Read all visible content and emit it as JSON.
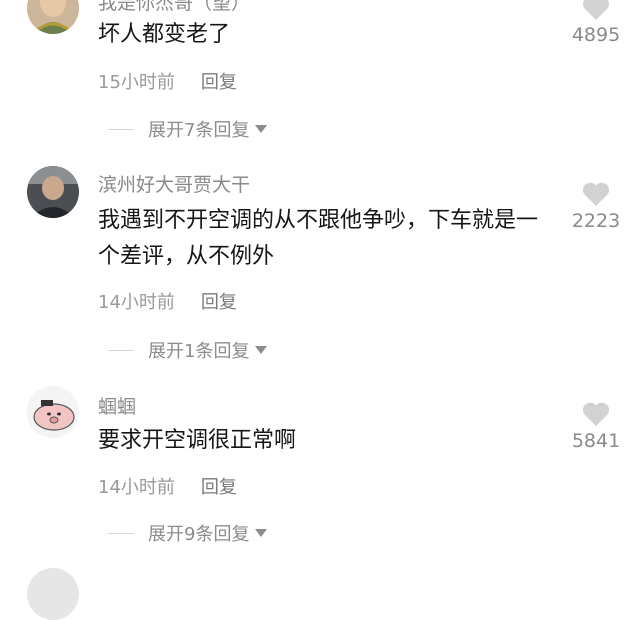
{
  "comments": [
    {
      "username": "我是你杰哥（望）",
      "text": "坏人都变老了",
      "time": "15小时前",
      "reply_label": "回复",
      "expand_label": "展开7条回复",
      "likes": "4895"
    },
    {
      "username": "滨州好大哥贾大干",
      "text": "我遇到不开空调的从不跟他争吵，下车就是一个差评，从不例外",
      "time": "14小时前",
      "reply_label": "回复",
      "expand_label": "展开1条回复",
      "likes": "2223"
    },
    {
      "username": "蝈蝈",
      "text": "要求开空调很正常啊",
      "time": "14小时前",
      "reply_label": "回复",
      "expand_label": "展开9条回复",
      "likes": "5841"
    }
  ],
  "colors": {
    "text": "#161616",
    "secondary": "#8a8a8a",
    "heart": "#d2d2d2"
  }
}
